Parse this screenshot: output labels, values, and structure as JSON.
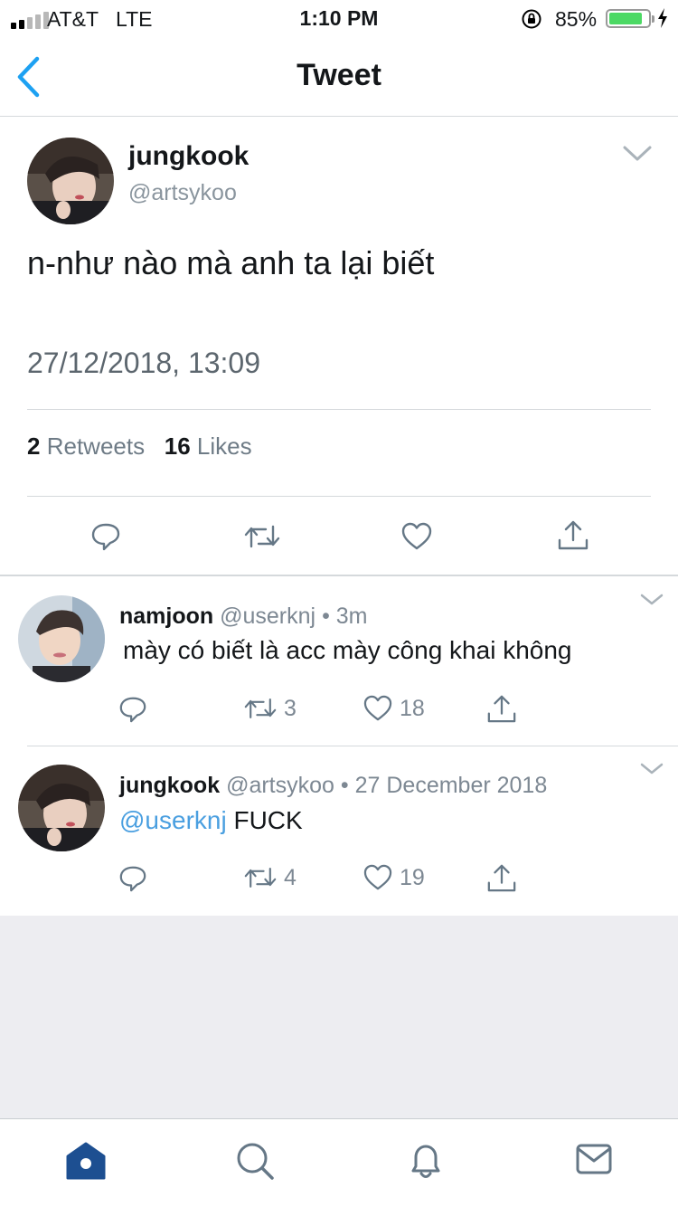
{
  "status_bar": {
    "carrier": "AT&T",
    "network": "LTE",
    "time": "1:10 PM",
    "battery_percent": "85%",
    "battery_level": 0.85,
    "signal_bars": 2
  },
  "nav": {
    "title": "Tweet",
    "back_icon": "chevron-left-icon"
  },
  "tweet": {
    "name": "jungkook",
    "handle": "@artsykoo",
    "text": "n-như nào mà anh ta lại biết",
    "timestamp": "27/12/2018, 13:09",
    "retweets_count": "2",
    "retweets_label": "Retweets",
    "likes_count": "16",
    "likes_label": "Likes",
    "actions": [
      "reply-icon",
      "retweet-icon",
      "like-icon",
      "share-icon"
    ]
  },
  "replies": [
    {
      "name": "namjoon",
      "handle": "@userknj",
      "time": "3m",
      "text": "mày có biết là acc mày công khai không",
      "retweets": "3",
      "likes": "18"
    },
    {
      "name": "jungkook",
      "handle": "@artsykoo",
      "time": "27 December 2018",
      "mention": "@userknj",
      "text": "FUCK",
      "retweets": "4",
      "likes": "19"
    }
  ],
  "tab_bar": {
    "items": [
      "home-icon",
      "search-icon",
      "notifications-icon",
      "messages-icon"
    ],
    "active": "home-icon"
  },
  "colors": {
    "accent": "#1da1f2",
    "muted_text": "#8a959e",
    "mention": "#4a9fe0",
    "battery": "#4cd964",
    "tab_active": "#1d4f91"
  }
}
